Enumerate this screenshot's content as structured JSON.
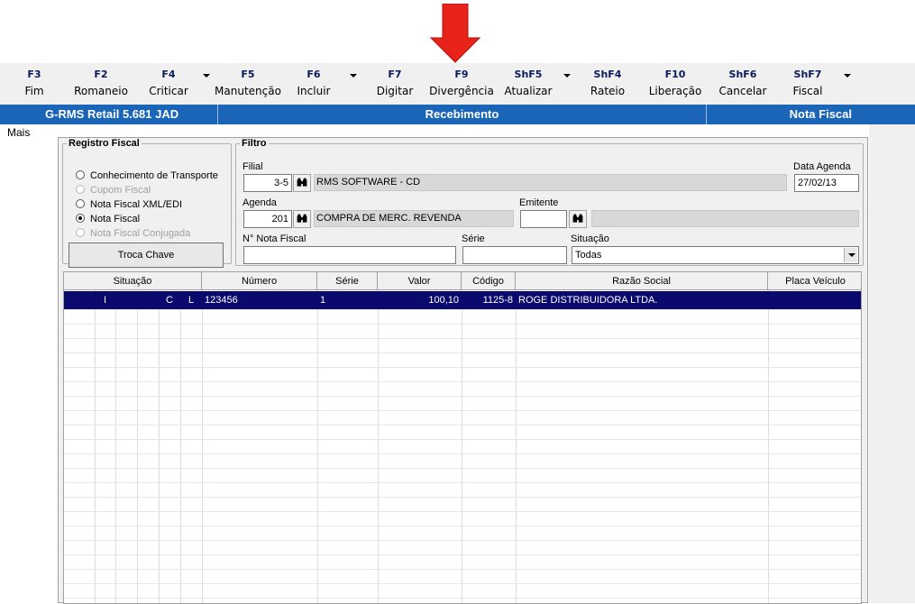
{
  "toolbar": {
    "buttons": [
      {
        "key": "F3",
        "label": "Fim"
      },
      {
        "key": "F2",
        "label": "Romaneio"
      },
      {
        "key": "F4",
        "label": "Criticar"
      },
      {
        "key": "F5",
        "label": "Manutenção"
      },
      {
        "key": "F6",
        "label": "Incluir"
      },
      {
        "key": "F7",
        "label": "Digitar"
      },
      {
        "key": "F9",
        "label": "Divergência"
      },
      {
        "key": "ShF5",
        "label": "Atualizar"
      },
      {
        "key": "ShF4",
        "label": "Rateio"
      },
      {
        "key": "F10",
        "label": "Liberação"
      },
      {
        "key": "ShF6",
        "label": "Cancelar"
      },
      {
        "key": "ShF7",
        "label": "Fiscal"
      }
    ]
  },
  "titlebar": {
    "app": "G-RMS Retail 5.681 JAD",
    "module": "Recebimento",
    "screen": "Nota Fiscal"
  },
  "mais": "Mais",
  "registro": {
    "legend": "Registro Fiscal",
    "options": [
      {
        "label": "Conhecimento de Transporte",
        "state": "enabled"
      },
      {
        "label": "Cupom Fiscal",
        "state": "disabled"
      },
      {
        "label": "Nota Fiscal XML/EDI",
        "state": "enabled"
      },
      {
        "label": "Nota Fiscal",
        "state": "selected"
      },
      {
        "label": "Nota Fiscal Conjugada",
        "state": "disabled"
      }
    ],
    "troca_chave": "Troca Chave"
  },
  "filtro": {
    "legend": "Filtro",
    "filial_label": "Filial",
    "filial_value": "3-5",
    "filial_name": "RMS SOFTWARE - CD",
    "data_agenda_label": "Data Agenda",
    "data_agenda_value": "27/02/13",
    "agenda_label": "Agenda",
    "agenda_value": "201",
    "agenda_name": "COMPRA DE MERC. REVENDA",
    "emitente_label": "Emitente",
    "emitente_value": "",
    "emitente_name": "",
    "nota_label": "N° Nota Fiscal",
    "nota_value": "",
    "serie_label": "Série",
    "serie_value": "",
    "situacao_label": "Situação",
    "situacao_value": "Todas"
  },
  "grid": {
    "headers": [
      "Situação",
      "Número",
      "Série",
      "Valor",
      "Código",
      "Razão Social",
      "Placa Veículo"
    ],
    "rows": [
      {
        "flags": [
          "",
          "I",
          "",
          "",
          "C",
          "L"
        ],
        "numero": "123456",
        "serie": "1",
        "valor": "100,10",
        "codigo": "1125-8",
        "razao": "ROGE DISTRIBUIDORA LTDA.",
        "placa": ""
      }
    ]
  },
  "colors": {
    "titlebar": "#1a65b8",
    "selected_row": "#0a0a6e",
    "arrow": "#e8241a"
  }
}
